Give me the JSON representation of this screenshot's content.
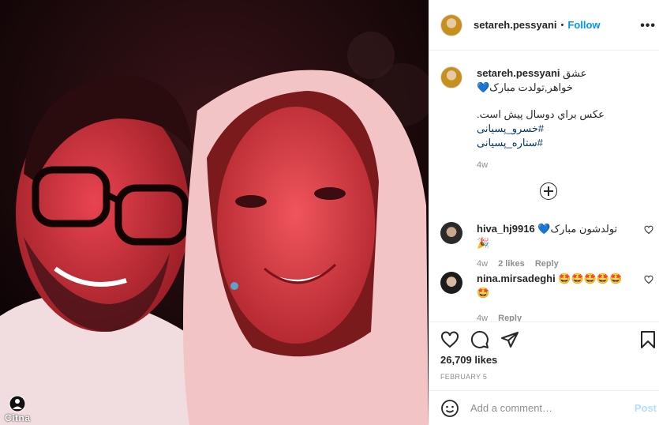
{
  "post": {
    "username": "setareh.pessyani",
    "follow_label": "Follow",
    "more_label": "•••"
  },
  "caption": {
    "username": "setareh.pessyani",
    "line1": "عشق خواهر,تولدت مبارک💙",
    "line2": "عکس براي دوسال پيش است.",
    "tag1": "#خسرو_پسيانی",
    "tag2": "#ستاره_پسيانی",
    "time": "4w"
  },
  "comments": [
    {
      "username": "hiva_hj9916",
      "text": "تولدشون مبارک💙🎉",
      "time": "4w",
      "likes": "2 likes",
      "reply": "Reply"
    },
    {
      "username": "nina.mirsadeghi",
      "text": "🤩🤩🤩🤩🤩🤩",
      "time": "4w",
      "reply": "Reply"
    }
  ],
  "likes_count": "26,709 likes",
  "date": "FEBRUARY 5",
  "add_comment_placeholder": "Add a comment…",
  "post_button": "Post",
  "watermark": "Citna",
  "icons": [
    "heart-icon",
    "comment-icon",
    "share-icon",
    "bookmark-icon",
    "smile-icon",
    "plus-circle-icon"
  ],
  "colors": {
    "accent": "#0095f6",
    "post_disabled": "#b2dffc",
    "tag": "#00376b"
  }
}
